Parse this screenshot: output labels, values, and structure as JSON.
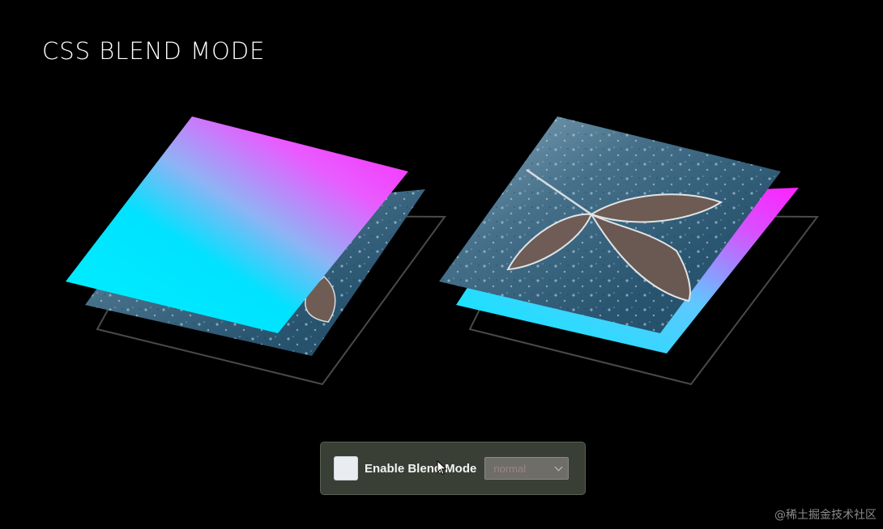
{
  "header": {
    "title": "CSS BLEND MODE"
  },
  "controls": {
    "checkbox_checked": false,
    "checkbox_label": "Enable Blend Mode",
    "blend_select": {
      "selected": "normal"
    }
  },
  "colors": {
    "background": "#000000",
    "gradient_cyan": "#00e5ff",
    "gradient_magenta": "#ff22ff",
    "panel_background": "#3a3f36",
    "frame_stroke": "#4a4f49"
  },
  "watermark": "@稀土掘金技术社区"
}
